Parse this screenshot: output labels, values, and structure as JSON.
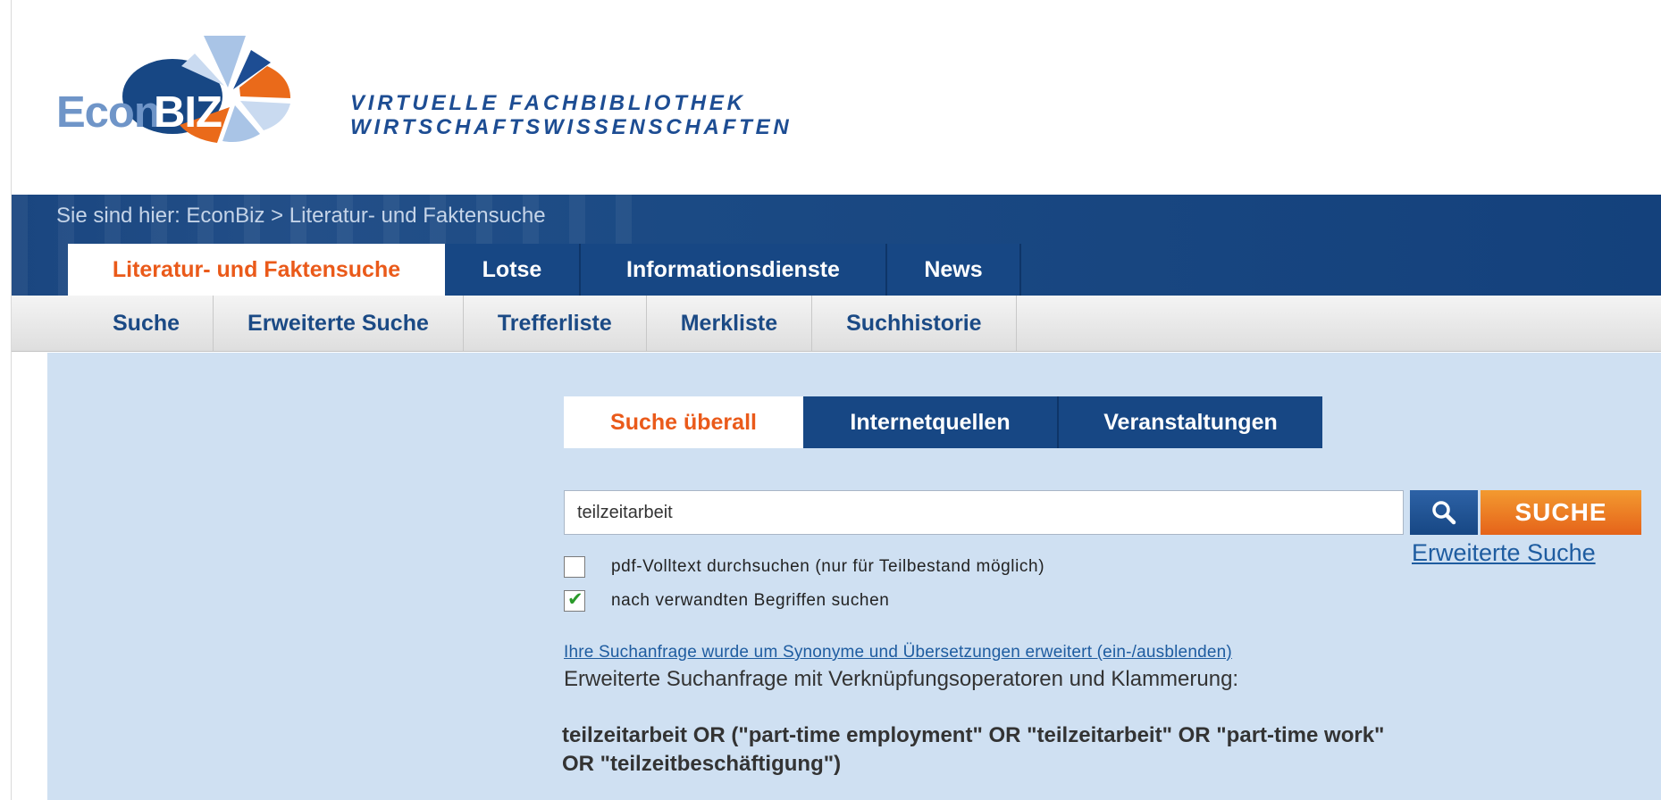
{
  "logo": {
    "econ": "Econ",
    "biz": "BIZ",
    "tagline_line1": "VIRTUELLE FACHBIBLIOTHEK",
    "tagline_line2": "WIRTSCHAFTSWISSENSCHAFTEN"
  },
  "breadcrumb": "Sie sind hier: EconBiz > Literatur- und Faktensuche",
  "main_tabs": [
    {
      "label": "Literatur- und Faktensuche",
      "active": true
    },
    {
      "label": "Lotse",
      "active": false
    },
    {
      "label": "Informationsdienste",
      "active": false
    },
    {
      "label": "News",
      "active": false
    }
  ],
  "sub_nav": [
    "Suche",
    "Erweiterte Suche",
    "Trefferliste",
    "Merkliste",
    "Suchhistorie"
  ],
  "search_tabs": [
    {
      "label": "Suche überall",
      "active": true
    },
    {
      "label": "Internetquellen",
      "active": false
    },
    {
      "label": "Veranstaltungen",
      "active": false
    }
  ],
  "search": {
    "value": "teilzeitarbeit",
    "button_label": "SUCHE",
    "advanced_link": "Erweiterte Suche"
  },
  "options": [
    {
      "label": "pdf-Volltext durchsuchen (nur für Teilbestand möglich)",
      "checked": false
    },
    {
      "label": "nach verwandten Begriffen suchen",
      "checked": true
    }
  ],
  "synonyms_link": "Ihre Suchanfrage wurde um Synonyme und Übersetzungen erweitert (ein-/ausblenden)",
  "extended_query_label": "Erweiterte Suchanfrage mit Verknüpfungsoperatoren und Klammerung:",
  "extended_query": "teilzeitarbeit OR (\"part-time employment\" OR \"teilzeitarbeit\" OR \"part-time work\" OR \"teilzeitbeschäftigung\")",
  "colors": {
    "brand_blue": "#174784",
    "accent_orange": "#ea5a1a",
    "panel_bg": "#cfe0f2"
  }
}
